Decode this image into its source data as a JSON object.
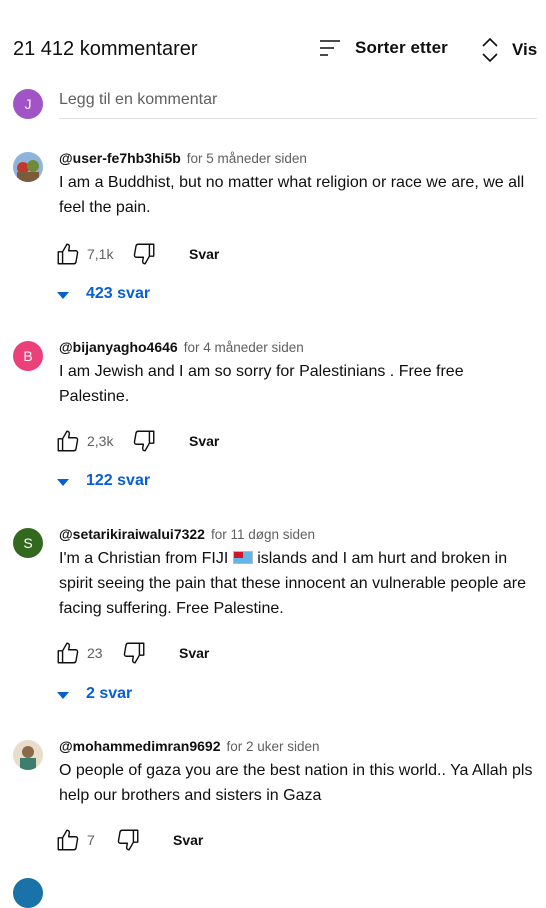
{
  "header": {
    "count": "21 412 kommentarer",
    "sort_label": "Sorter etter",
    "vis_label": "Vis"
  },
  "add_comment": {
    "avatar_letter": "J",
    "placeholder": "Legg til en kommentar"
  },
  "comments": [
    {
      "author": "@user-fe7hb3hi5b",
      "time": "for 5 måneder siden",
      "text": "I am a Buddhist, but no matter what religion or race we are, we all feel the pain.",
      "likes": "7,1k",
      "reply": "Svar",
      "replies": "423 svar",
      "avatar_letter": ""
    },
    {
      "author": "@bijanyagho4646",
      "time": "for 4 måneder siden",
      "text": "I am Jewish and I am so sorry for Palestinians . Free free Palestine.",
      "likes": "2,3k",
      "reply": "Svar",
      "replies": "122 svar",
      "avatar_letter": "B"
    },
    {
      "author": "@setarikiraiwalui7322",
      "time": "for 11 døgn siden",
      "text_before_flag": "I'm a Christian from FIJI ",
      "text_after_flag": " islands and I am hurt and broken in spirit seeing the pain that these innocent an vulnerable people are facing suffering.  Free Palestine.",
      "likes": "23",
      "reply": "Svar",
      "replies": "2 svar",
      "avatar_letter": "S"
    },
    {
      "author": "@mohammedimran9692",
      "time": "for 2 uker siden",
      "text": "O people of gaza you are the best nation in this world.. Ya Allah pls help our brothers and sisters in Gaza",
      "likes": "7",
      "reply": "Svar",
      "avatar_letter": ""
    }
  ],
  "colors": {
    "accent_blue": "#065fd4",
    "avatar_j": "#a154c5",
    "avatar_b": "#ec407a",
    "avatar_s": "#33691e"
  },
  "icons": [
    "sort-icon",
    "vis-chevron-icon",
    "like-icon",
    "dislike-icon",
    "expand-caret-icon"
  ]
}
